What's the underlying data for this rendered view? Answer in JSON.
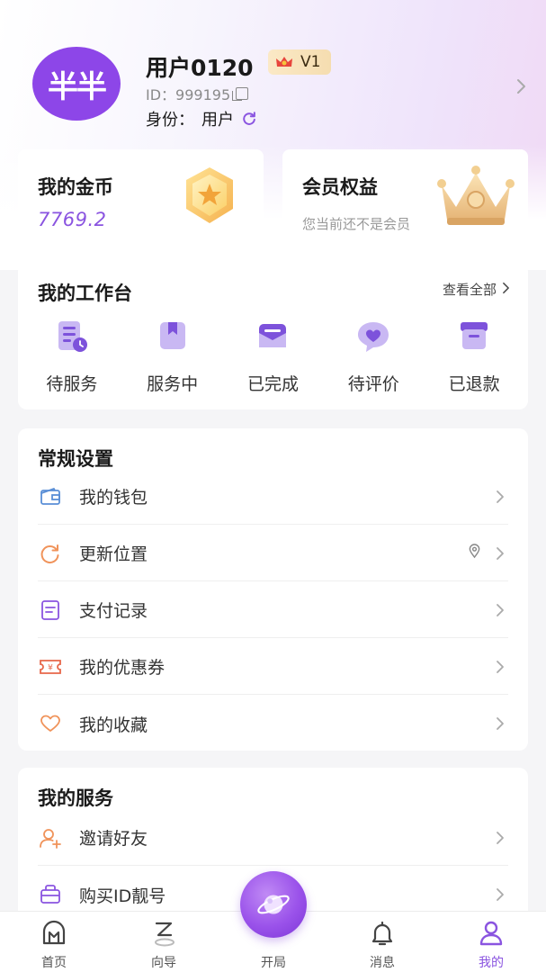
{
  "profile": {
    "avatar_text": "半半",
    "username": "用户0120",
    "vip_level": "V1",
    "id_text": "ID：999195",
    "identity_label": "身份：",
    "identity_value": "用户"
  },
  "coins": {
    "title": "我的金币",
    "value": "7769.2"
  },
  "membership": {
    "title": "会员权益",
    "subtitle": "您当前还不是会员"
  },
  "workbench": {
    "title": "我的工作台",
    "view_all": "查看全部",
    "items": [
      {
        "label": "待服务",
        "icon": "pending-service-icon"
      },
      {
        "label": "服务中",
        "icon": "in-service-icon"
      },
      {
        "label": "已完成",
        "icon": "completed-icon"
      },
      {
        "label": "待评价",
        "icon": "to-review-icon"
      },
      {
        "label": "已退款",
        "icon": "refunded-icon"
      }
    ]
  },
  "settings": {
    "title": "常规设置",
    "items": [
      {
        "label": "我的钱包",
        "icon": "wallet-icon"
      },
      {
        "label": "更新位置",
        "icon": "refresh-location-icon"
      },
      {
        "label": "支付记录",
        "icon": "payment-record-icon"
      },
      {
        "label": "我的优惠券",
        "icon": "coupon-icon"
      },
      {
        "label": "我的收藏",
        "icon": "heart-icon"
      }
    ]
  },
  "services": {
    "title": "我的服务",
    "items": [
      {
        "label": "邀请好友",
        "icon": "invite-friend-icon"
      },
      {
        "label": "购买ID靓号",
        "icon": "buy-id-icon"
      }
    ]
  },
  "tabbar": {
    "items": [
      {
        "label": "首页",
        "icon": "home-icon"
      },
      {
        "label": "向导",
        "icon": "guide-icon"
      },
      {
        "label": "开局",
        "icon": "planet-icon"
      },
      {
        "label": "消息",
        "icon": "bell-icon"
      },
      {
        "label": "我的",
        "icon": "profile-icon"
      }
    ],
    "active": "我的"
  },
  "colors": {
    "accent": "#8a54e0",
    "gold": "#f4c04a",
    "orange": "#f0935a"
  }
}
